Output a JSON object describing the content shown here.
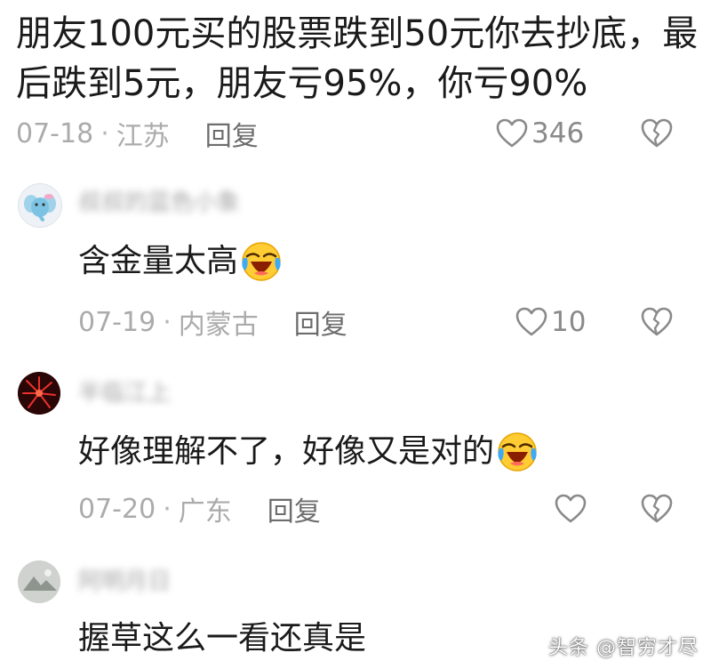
{
  "main_comment": {
    "text": "朋友100元买的股票跌到50元你去抄底，最后跌到5元，朋友亏95%，你亏90%",
    "date": "07-18",
    "location": "江苏",
    "reply_label": "回复",
    "likes": "346"
  },
  "replies": [
    {
      "username": "叔叔的蓝色小象",
      "text": "含金量太高",
      "date": "07-19",
      "location": "内蒙古",
      "reply_label": "回复",
      "likes": "10"
    },
    {
      "username": "半临江上",
      "text": "好像理解不了，好像又是对的",
      "date": "07-20",
      "location": "广东",
      "reply_label": "回复",
      "likes": ""
    },
    {
      "username": "阿明月日",
      "text": "握草这么一看还真是"
    }
  ],
  "meta_separator": "·",
  "watermark": "头条 @智穷才尽",
  "icons": {
    "like": "heart-outline-icon",
    "dislike": "broken-heart-icon",
    "emoji": "laughing-crying-emoji-icon"
  },
  "colors": {
    "text": "#1a1a1a",
    "meta": "#ababab",
    "reply": "#6d6d6d",
    "icon": "#8a8a8a"
  }
}
